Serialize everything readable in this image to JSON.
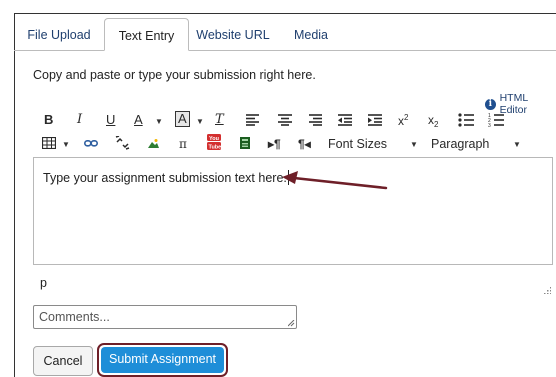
{
  "tabs": [
    {
      "label": "File Upload",
      "active": false
    },
    {
      "label": "Text Entry",
      "active": true
    },
    {
      "label": "Website URL",
      "active": false
    },
    {
      "label": "Media",
      "active": false
    }
  ],
  "instructions": "Copy and paste or type your submission right here.",
  "html_editor_link": "HTML Editor",
  "toolbar": {
    "row1": [
      "bold-icon",
      "italic-icon",
      "underline-icon",
      "text-color-icon",
      "background-color-icon",
      "clear-formatting-icon",
      "align-left-icon",
      "align-center-icon",
      "align-right-icon",
      "outdent-icon",
      "indent-icon",
      "superscript-icon",
      "subscript-icon",
      "bullet-list-icon",
      "numbered-list-icon"
    ],
    "row2": [
      "table-icon",
      "link-icon",
      "unlink-icon",
      "image-icon",
      "math-equation-icon",
      "media-icon",
      "document-icon",
      "ltr-icon",
      "rtl-icon"
    ],
    "font_sizes_label": "Font Sizes",
    "paragraph_label": "Paragraph"
  },
  "editor": {
    "content": "Type your assignment submission text here.",
    "path": "p"
  },
  "comments": {
    "placeholder": "Comments..."
  },
  "actions": {
    "cancel_label": "Cancel",
    "submit_label": "Submit Assignment"
  },
  "colors": {
    "link": "#1f3f6e",
    "submit_bg": "#1e8ed8",
    "annotation": "#6e1f28"
  }
}
